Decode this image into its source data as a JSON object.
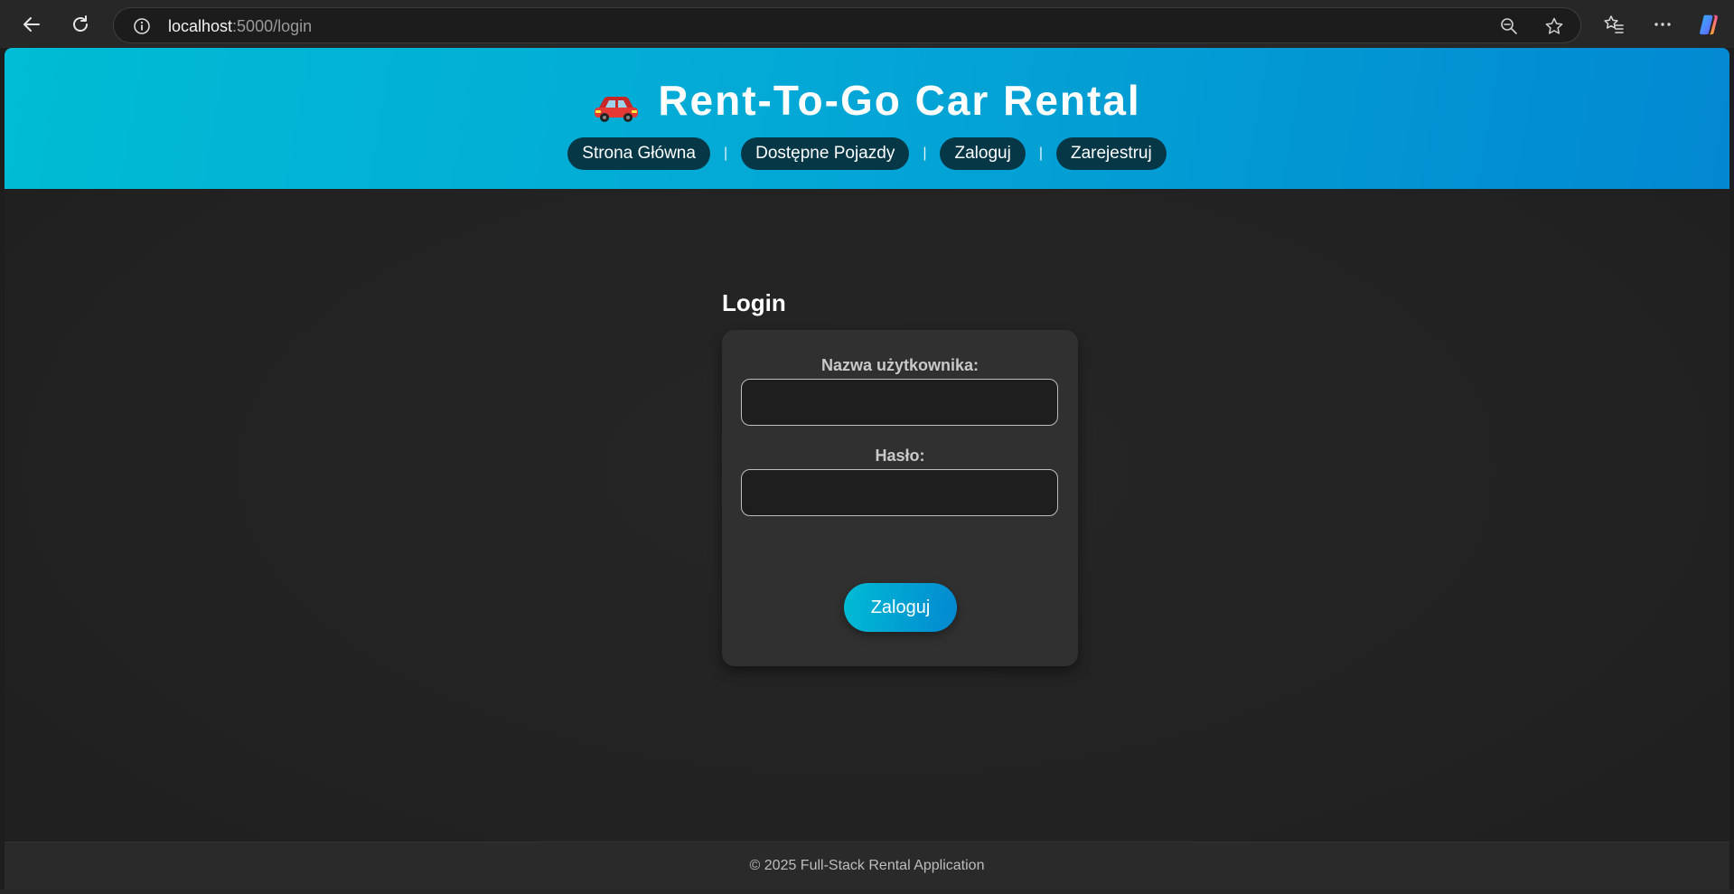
{
  "browser": {
    "url_host": "localhost",
    "url_path": ":5000/login",
    "icons": {
      "back": "back-arrow-icon",
      "reload": "reload-icon",
      "site_info": "info-icon",
      "zoom": "zoom-out-icon",
      "favorite": "star-icon",
      "favorites_list": "favorites-icon",
      "menu": "more-icon",
      "copilot": "copilot-icon"
    }
  },
  "header": {
    "title": "Rent-To-Go Car Rental",
    "logo_icon": "car-icon",
    "nav": {
      "home": "Strona Główna",
      "vehicles": "Dostępne Pojazdy",
      "login": "Zaloguj",
      "register": "Zarejestruj",
      "separator": "|"
    }
  },
  "main": {
    "heading": "Login",
    "form": {
      "username_label": "Nazwa użytkownika:",
      "username_value": "",
      "password_label": "Hasło:",
      "password_value": "",
      "submit_label": "Zaloguj"
    }
  },
  "footer": {
    "text": "© 2025 Full-Stack Rental Application"
  },
  "colors": {
    "header_gradient_start": "#00bcd4",
    "header_gradient_end": "#0288d1",
    "nav_pill": "#063746",
    "page_background": "#222222",
    "card_background": "#303030"
  }
}
